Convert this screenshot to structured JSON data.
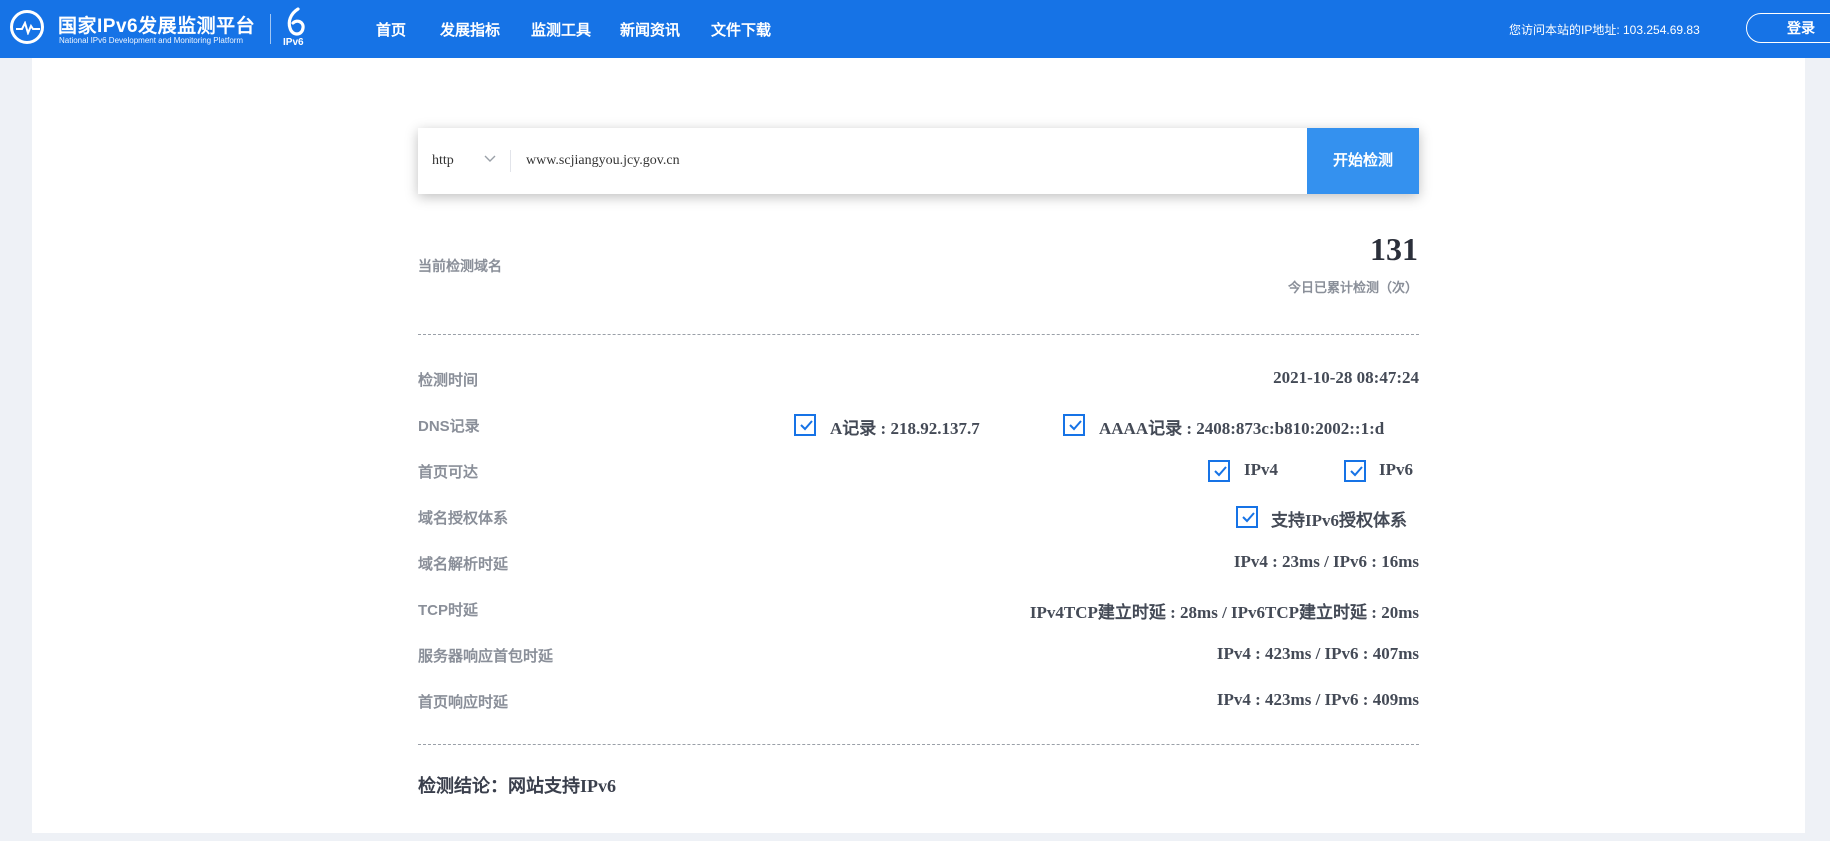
{
  "header": {
    "brand_title": "国家IPv6发展监测平台",
    "brand_subtitle": "National IPv6 Development and Monitoring Platform",
    "ipv6_badge": "IPv6",
    "nav": [
      "首页",
      "发展指标",
      "监测工具",
      "新闻资讯",
      "文件下载"
    ],
    "visitor_ip": "您访问本站的IP地址: 103.254.69.83",
    "login_label": "登录"
  },
  "search": {
    "protocol": "http",
    "domain": "www.scjiangyou.jcy.gov.cn",
    "button_label": "开始检测"
  },
  "stats": {
    "current_label": "当前检测域名",
    "count": "131",
    "count_caption": "今日已累计检测（次）"
  },
  "rows": {
    "time": {
      "label": "检测时间",
      "value": "2021-10-28 08:47:24"
    },
    "dns": {
      "label": "DNS记录",
      "a": "A记录 : 218.92.137.7",
      "aaaa": "AAAA记录 : 2408:873c:b810:2002::1:d"
    },
    "reach": {
      "label": "首页可达",
      "ipv4": "IPv4",
      "ipv6": "IPv6"
    },
    "auth": {
      "label": "域名授权体系",
      "value": "支持IPv6授权体系"
    },
    "resolve": {
      "label": "域名解析时延",
      "value": "IPv4 : 23ms / IPv6 : 16ms"
    },
    "tcp": {
      "label": "TCP时延",
      "value": "IPv4TCP建立时延 : 28ms / IPv6TCP建立时延 : 20ms"
    },
    "server": {
      "label": "服务器响应首包时延",
      "value": "IPv4 : 423ms / IPv6 : 407ms"
    },
    "page": {
      "label": "首页响应时延",
      "value": "IPv4 : 423ms / IPv6 : 409ms"
    }
  },
  "conclusion": "检测结论：网站支持IPv6",
  "colors": {
    "header_bg": "#1673e6",
    "accent": "#3491ef",
    "check": "#1673e6"
  },
  "icons": [
    "platform-logo-icon",
    "ipv6-badge-icon",
    "chevron-down-icon",
    "checkbox-checked-icon"
  ]
}
